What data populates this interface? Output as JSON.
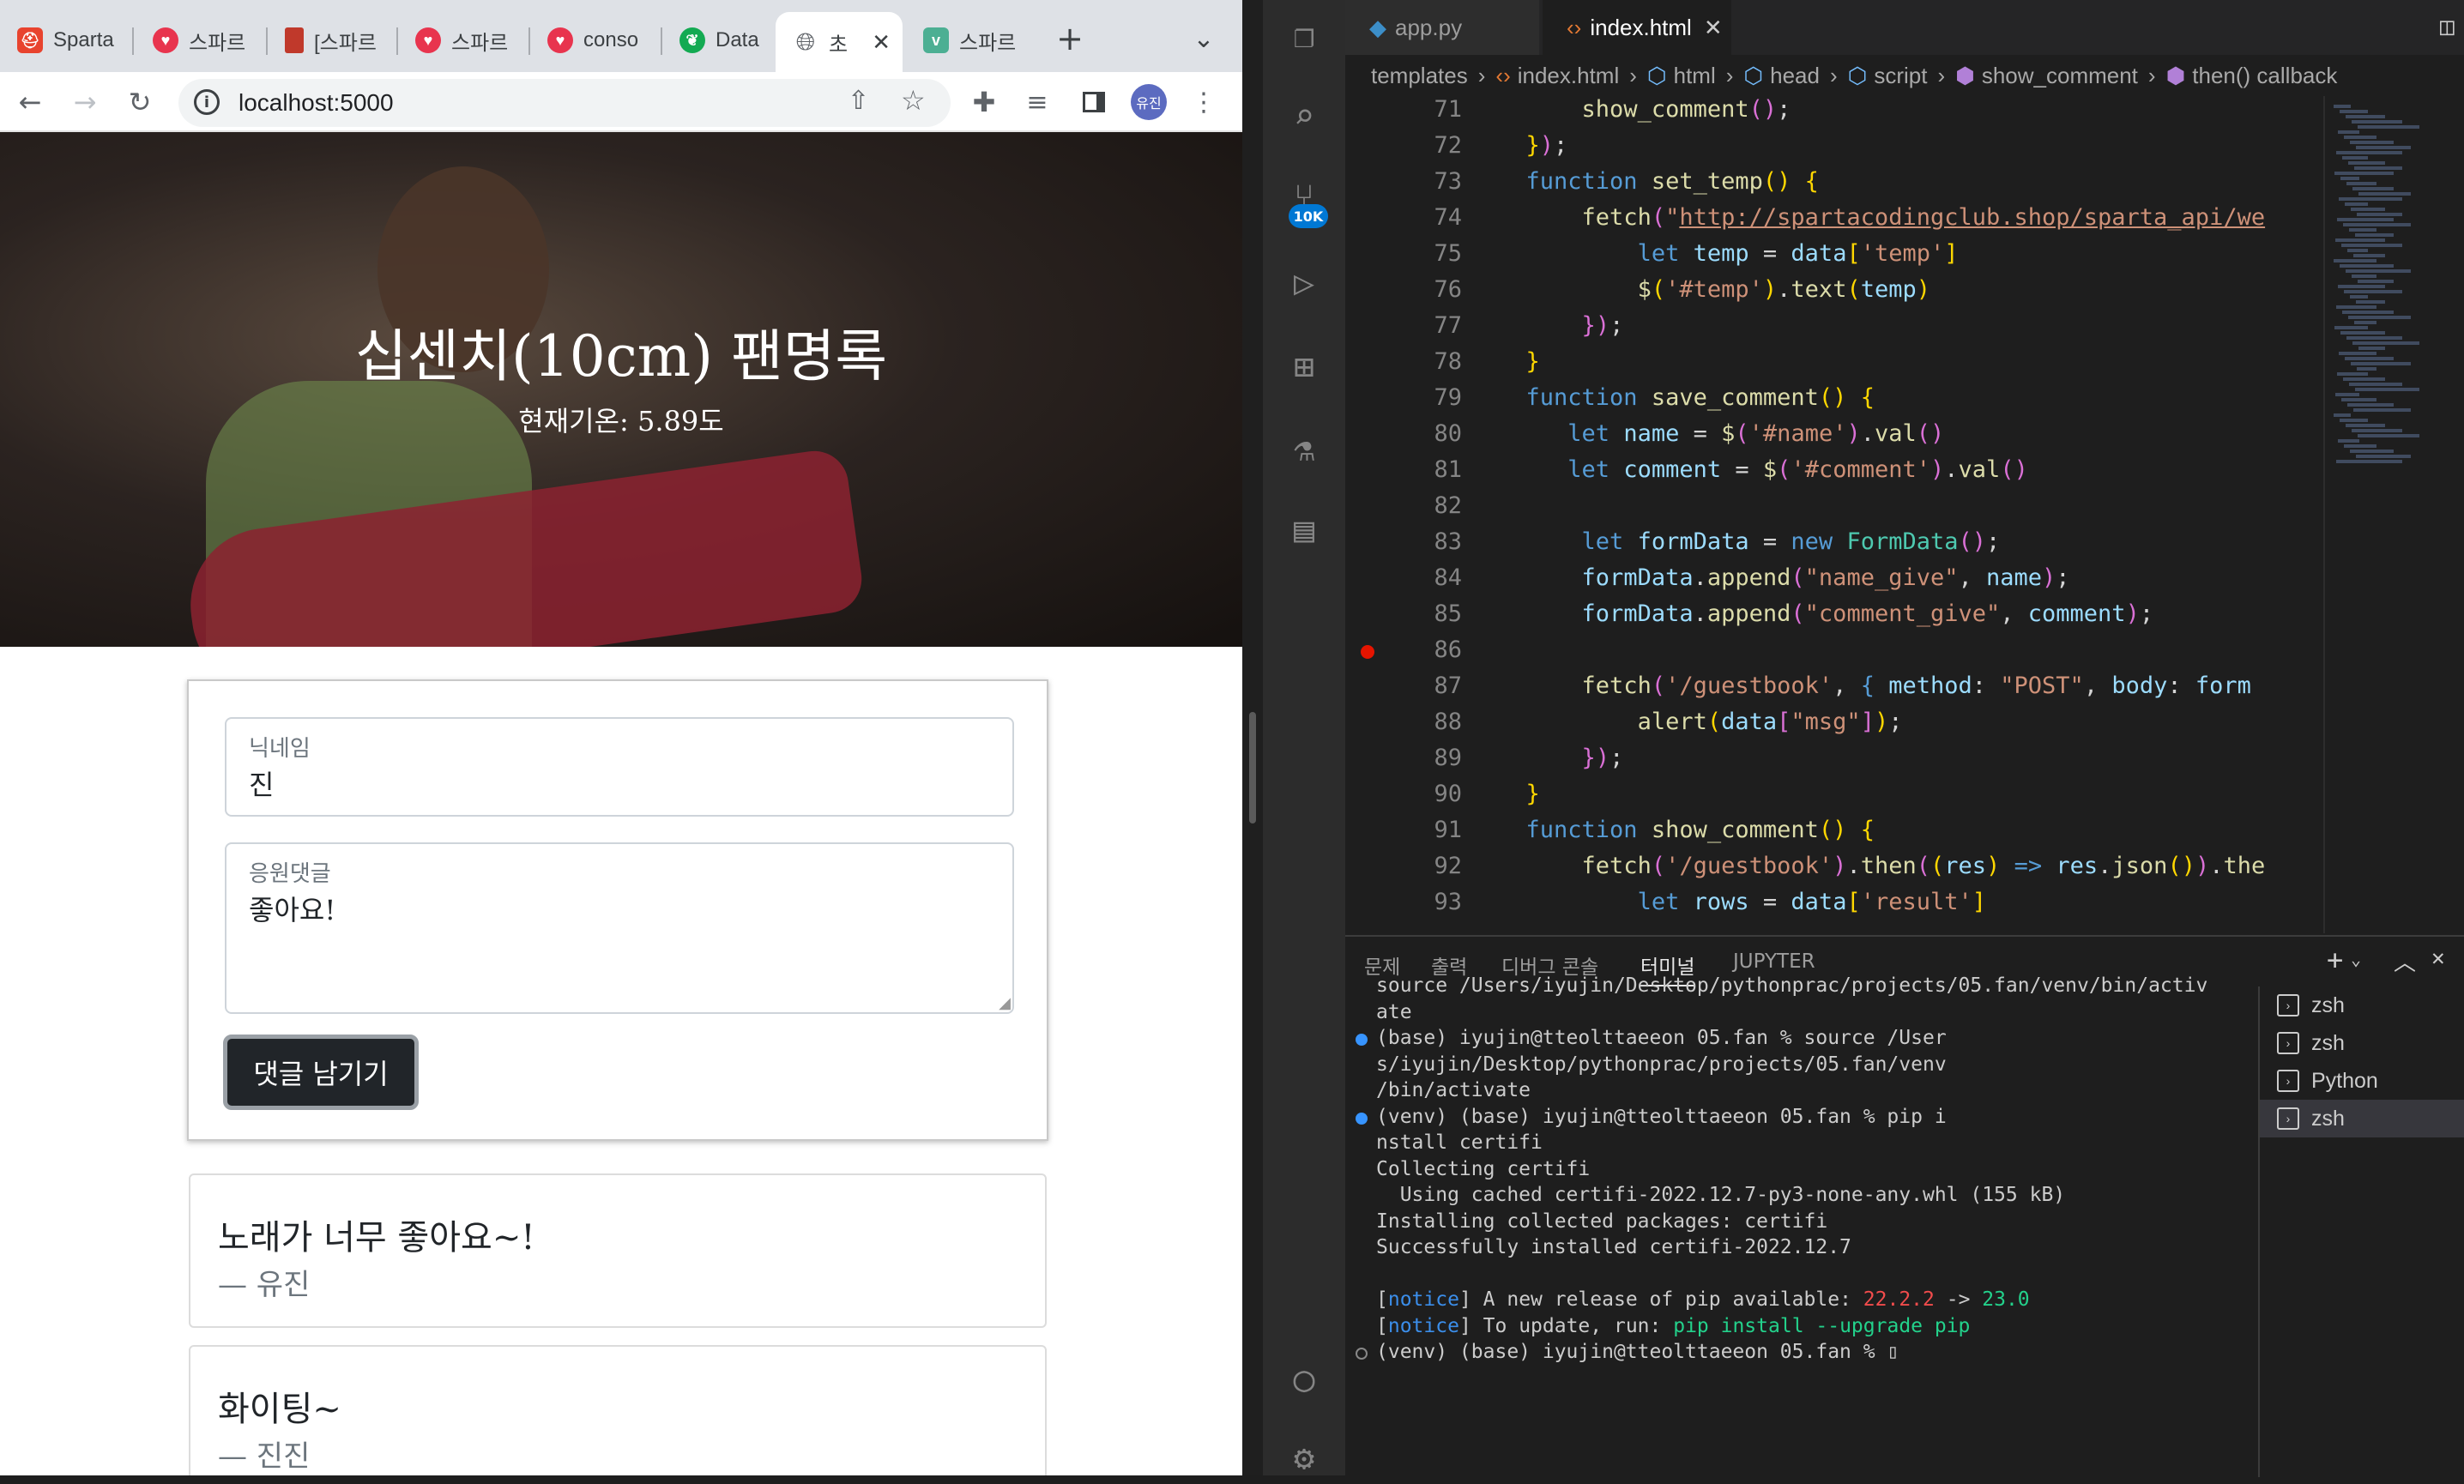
{
  "browser": {
    "tabs": [
      {
        "label": "Sparta",
        "icon": "sparta-icon",
        "color": "#e8432e"
      },
      {
        "label": "스파르",
        "icon": "sparta-heart-icon",
        "color": "#e8344e"
      },
      {
        "label": "[스파르",
        "icon": "book-icon",
        "color": "#c0392b"
      },
      {
        "label": "스파르",
        "icon": "sparta-heart-icon",
        "color": "#e8344e"
      },
      {
        "label": "conso",
        "icon": "sparta-heart-icon",
        "color": "#e8344e"
      },
      {
        "label": "Data",
        "icon": "mongodb-leaf-icon",
        "color": "#13aa52"
      },
      {
        "label": "초",
        "icon": "globe-icon",
        "color": "#5f6368"
      },
      {
        "label": "스파르",
        "icon": "v-icon",
        "color": "#4caf93"
      }
    ],
    "new_tab": "+",
    "tab_menu": "⌄",
    "url": "localhost:5000",
    "profile": "유진"
  },
  "page": {
    "title": "십센치(10cm) 팬명록",
    "temp_label": "현재기온:",
    "temp_value": "5.89도",
    "name_label": "닉네임",
    "name_value": "진",
    "comment_label": "응원댓글",
    "comment_value": "좋아요!",
    "save_button": "댓글 남기기",
    "comments": [
      {
        "text": "노래가 너무 좋아요~!",
        "name": "— 유진"
      },
      {
        "text": "화이팅~",
        "name": "— 진진"
      }
    ]
  },
  "vscode": {
    "badge": "10K",
    "tabs": [
      {
        "label": "app.py",
        "active": false
      },
      {
        "label": "index.html",
        "active": true
      }
    ],
    "breadcrumbs": [
      "templates",
      "index.html",
      "html",
      "head",
      "script",
      "show_comment",
      "then() callback"
    ],
    "line_numbers": [
      "71",
      "72",
      "73",
      "74",
      "75",
      "76",
      "77",
      "78",
      "79",
      "80",
      "81",
      "82",
      "83",
      "84",
      "85",
      "86",
      "87",
      "88",
      "89",
      "90",
      "91",
      "92",
      "93"
    ],
    "panel_tabs": [
      "문제",
      "출력",
      "디버그 콘솔",
      "터미널",
      "JUPYTER"
    ],
    "active_panel_tab": "터미널",
    "terminal_lines": [
      {
        "text": "source /Users/iyujin/Desktop/pythonprac/projects/05.fan/venv/bin/activ",
        "dot": ""
      },
      {
        "text": "ate",
        "dot": ""
      },
      {
        "text": "(base) iyujin@tteolttaeeon 05.fan % source /User",
        "dot": "blue"
      },
      {
        "text": "s/iyujin/Desktop/pythonprac/projects/05.fan/venv",
        "dot": ""
      },
      {
        "text": "/bin/activate",
        "dot": ""
      },
      {
        "text": "(venv) (base) iyujin@tteolttaeeon 05.fan % pip i",
        "dot": "blue"
      },
      {
        "text": "nstall certifi",
        "dot": ""
      },
      {
        "text": "Collecting certifi",
        "dot": ""
      },
      {
        "text": "  Using cached certifi-2022.12.7-py3-none-any.whl (155 kB)",
        "dot": ""
      },
      {
        "text": "Installing collected packages: certifi",
        "dot": ""
      },
      {
        "text": "Successfully installed certifi-2022.12.7",
        "dot": ""
      },
      {
        "text": "",
        "dot": ""
      },
      {
        "text": "[notice] A new release of pip available: 22.2.2 -> 23.0",
        "dot": ""
      },
      {
        "text": "[notice] To update, run: pip install --upgrade pip",
        "dot": ""
      },
      {
        "text": "(venv) (base) iyujin@tteolttaeeon 05.fan % ▯",
        "dot": "hollow"
      }
    ],
    "terminals": [
      "zsh",
      "zsh",
      "Python",
      "zsh"
    ]
  },
  "colors": {
    "accent": "#0078d4",
    "breakpoint": "#e51400",
    "button_dark": "#212529"
  }
}
